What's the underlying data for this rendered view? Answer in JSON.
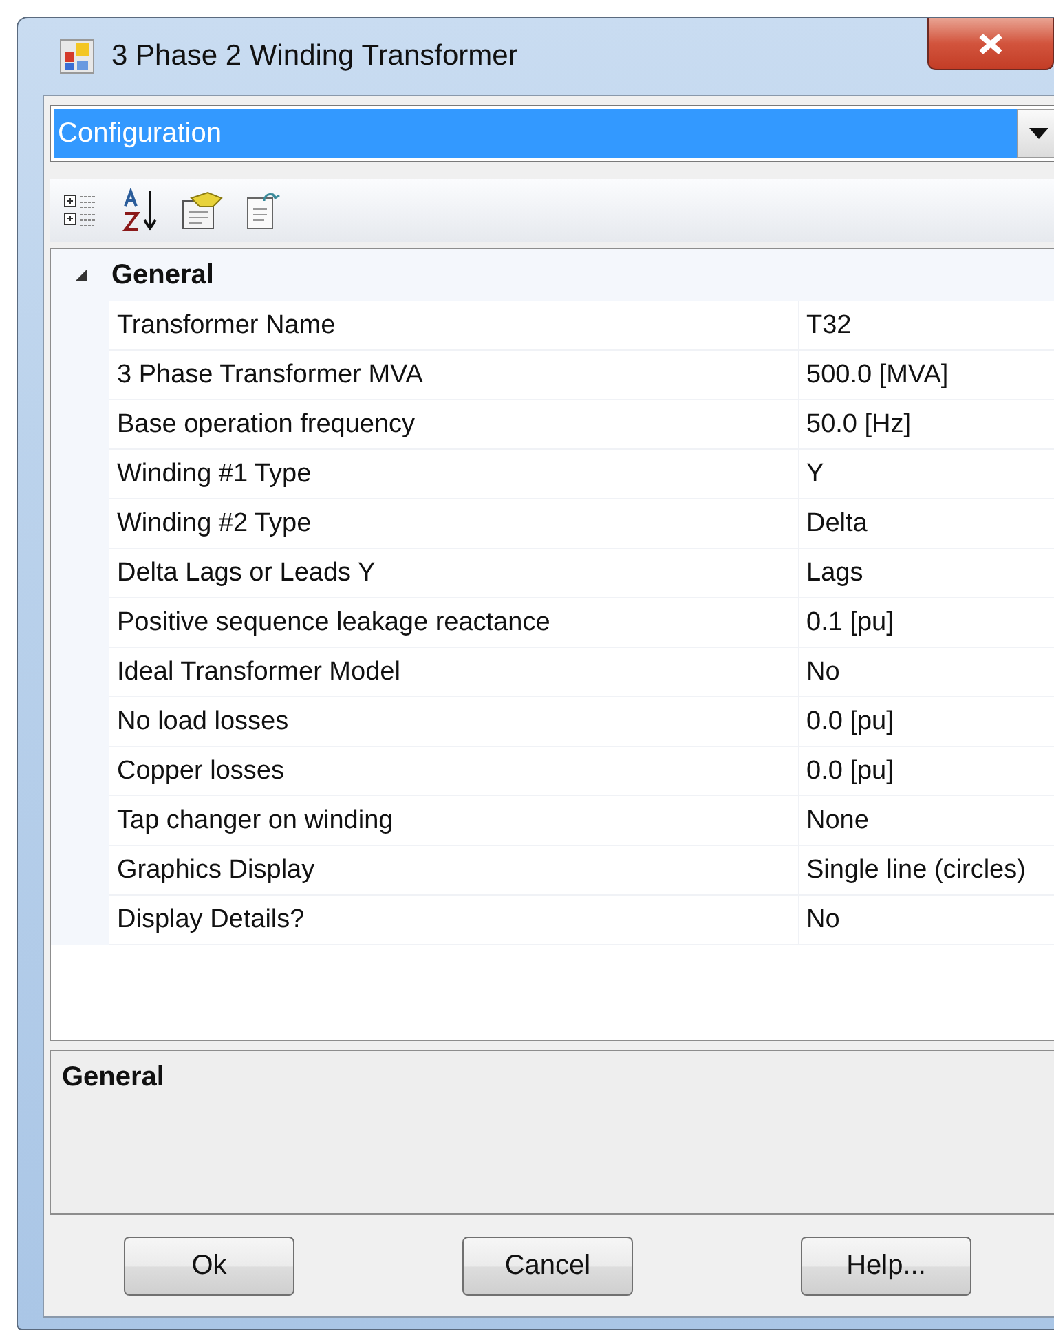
{
  "window": {
    "title": "3 Phase 2 Winding Transformer"
  },
  "selector": {
    "value": "Configuration"
  },
  "grid": {
    "categories": [
      {
        "label": "General",
        "expanded": true,
        "properties": [
          {
            "name": "Transformer Name",
            "value": "T32"
          },
          {
            "name": "3 Phase Transformer MVA",
            "value": "500.0 [MVA]"
          },
          {
            "name": "Base operation frequency",
            "value": "50.0 [Hz]"
          },
          {
            "name": "Winding #1 Type",
            "value": "Y"
          },
          {
            "name": "Winding #2 Type",
            "value": "Delta"
          },
          {
            "name": "Delta Lags or Leads Y",
            "value": "Lags"
          },
          {
            "name": "Positive sequence leakage reactance",
            "value": "0.1 [pu]"
          },
          {
            "name": "Ideal Transformer Model",
            "value": "No"
          },
          {
            "name": "No load losses",
            "value": "0.0 [pu]"
          },
          {
            "name": "Copper losses",
            "value": "0.0 [pu]"
          },
          {
            "name": "Tap changer on winding",
            "value": "None"
          },
          {
            "name": "Graphics Display",
            "value": "Single line (circles)"
          },
          {
            "name": "Display Details?",
            "value": "No"
          }
        ]
      }
    ]
  },
  "description": {
    "title": "General"
  },
  "buttons": [
    "Ok",
    "Cancel",
    "Help..."
  ]
}
